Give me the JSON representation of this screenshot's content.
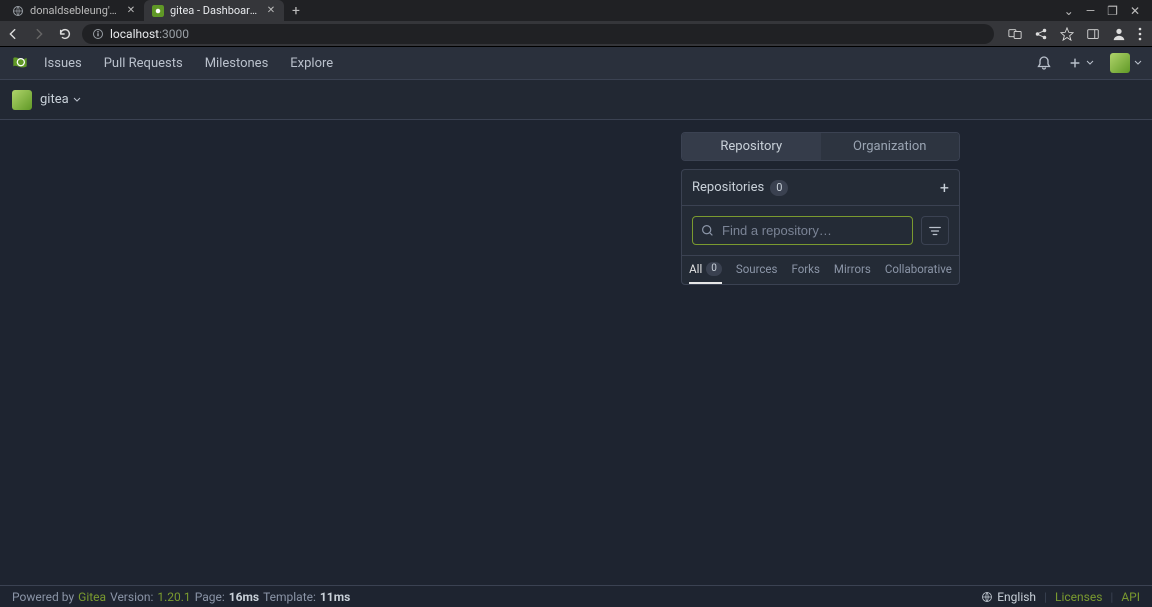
{
  "browser": {
    "tabs": [
      {
        "title": "donaldsebleung's blog",
        "active": false
      },
      {
        "title": "gitea - Dashboard - Gitea: G",
        "active": true
      }
    ],
    "url_host": "localhost",
    "url_port": ":3000"
  },
  "header": {
    "nav": {
      "issues": "Issues",
      "pull_requests": "Pull Requests",
      "milestones": "Milestones",
      "explore": "Explore"
    }
  },
  "context": {
    "name": "gitea"
  },
  "panel": {
    "tabs": {
      "repository": "Repository",
      "organization": "Organization"
    },
    "repos_label": "Repositories",
    "repos_count": "0",
    "search_placeholder": "Find a repository…",
    "filter_tabs": {
      "all": "All",
      "all_count": "0",
      "sources": "Sources",
      "forks": "Forks",
      "mirrors": "Mirrors",
      "collaborative": "Collaborative"
    }
  },
  "footer": {
    "powered_by": "Powered by ",
    "gitea": "Gitea",
    "version_label": " Version: ",
    "version": "1.20.1",
    "page_label": " Page: ",
    "page_time": "16ms",
    "template_label": " Template: ",
    "template_time": "11ms",
    "language": "English",
    "licenses": "Licenses",
    "api": "API"
  }
}
